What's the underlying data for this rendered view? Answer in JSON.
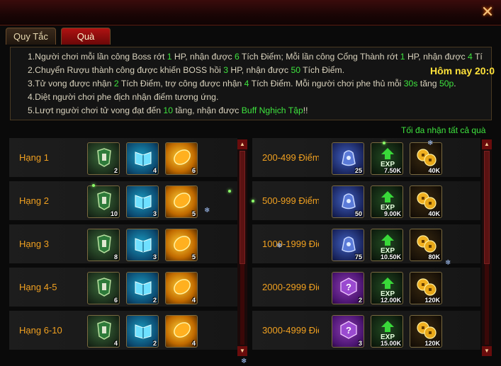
{
  "tabs": [
    {
      "label": "Quy Tắc",
      "active": false
    },
    {
      "label": "Quà",
      "active": true
    }
  ],
  "close_icon": "close-x-icon",
  "rules": [
    [
      "1.Người chơi mỗi lần công Boss rớt ",
      "1",
      " HP, nhận được ",
      "6",
      " Tích Điểm; Mỗi lần công Cổng Thành rớt ",
      "1",
      " HP, nhận được ",
      "4",
      " Tí"
    ],
    [
      "2.Chuyển Rượu thành công được khiến BOSS hồi ",
      "3",
      " HP, nhận được ",
      "50",
      " Tích Điểm."
    ],
    [
      "3.Tử vong được nhận ",
      "2",
      " Tích Điểm, trợ công được nhận ",
      "4",
      " Tích Điểm. Mỗi người chơi phe thủ mỗi ",
      "30s",
      " tăng ",
      "50p",
      "."
    ],
    [
      "4.Diệt người chơi phe địch nhận điểm tương ứng."
    ],
    [
      "5.Lượt người chơi tử vong đạt đến ",
      "10",
      " tầng, nhận được ",
      "Buff Nghịch Tập",
      "!!"
    ]
  ],
  "today_label": "Hôm nay 20:0",
  "claim_all_label": "Tối đa nhận tất cả quà",
  "rank_rewards": [
    {
      "label": "Hạng 1",
      "items": [
        {
          "icon": "armor-icon",
          "count": "2"
        },
        {
          "icon": "book-icon",
          "count": "4"
        },
        {
          "icon": "gold-egg-icon",
          "count": "6"
        }
      ]
    },
    {
      "label": "Hạng 2",
      "items": [
        {
          "icon": "armor-icon",
          "count": "10"
        },
        {
          "icon": "book-icon",
          "count": "3"
        },
        {
          "icon": "gold-egg-icon",
          "count": "5"
        }
      ]
    },
    {
      "label": "Hạng 3",
      "items": [
        {
          "icon": "armor-icon",
          "count": "8"
        },
        {
          "icon": "book-icon",
          "count": "3"
        },
        {
          "icon": "gold-egg-icon",
          "count": "5"
        }
      ]
    },
    {
      "label": "Hạng 4-5",
      "items": [
        {
          "icon": "armor-icon",
          "count": "6"
        },
        {
          "icon": "book-icon",
          "count": "2"
        },
        {
          "icon": "gold-egg-icon",
          "count": "4"
        }
      ]
    },
    {
      "label": "Hạng 6-10",
      "items": [
        {
          "icon": "armor-icon",
          "count": "4"
        },
        {
          "icon": "book-icon",
          "count": "2"
        },
        {
          "icon": "gold-egg-icon",
          "count": "4"
        }
      ]
    }
  ],
  "point_rewards": [
    {
      "label": "200-499 Điểm",
      "items": [
        {
          "icon": "blue-bag-icon",
          "count": "25"
        },
        {
          "icon": "exp-icon",
          "count": "7.50K"
        },
        {
          "icon": "coins-icon",
          "count": "40K"
        }
      ]
    },
    {
      "label": "500-999 Điểm",
      "items": [
        {
          "icon": "blue-bag-icon",
          "count": "50"
        },
        {
          "icon": "exp-icon",
          "count": "9.00K"
        },
        {
          "icon": "coins-icon",
          "count": "40K"
        }
      ]
    },
    {
      "label": "1000-1999 Điể",
      "items": [
        {
          "icon": "blue-bag-icon",
          "count": "75"
        },
        {
          "icon": "exp-icon",
          "count": "10.50K"
        },
        {
          "icon": "coins-icon",
          "count": "80K"
        }
      ]
    },
    {
      "label": "2000-2999 Điể",
      "items": [
        {
          "icon": "mystery-box-icon",
          "count": "2"
        },
        {
          "icon": "exp-icon",
          "count": "12.00K"
        },
        {
          "icon": "coins-icon",
          "count": "120K"
        }
      ]
    },
    {
      "label": "3000-4999 Điể",
      "items": [
        {
          "icon": "mystery-box-icon",
          "count": "3"
        },
        {
          "icon": "exp-icon",
          "count": "15.00K"
        },
        {
          "icon": "coins-icon",
          "count": "120K"
        }
      ]
    }
  ]
}
